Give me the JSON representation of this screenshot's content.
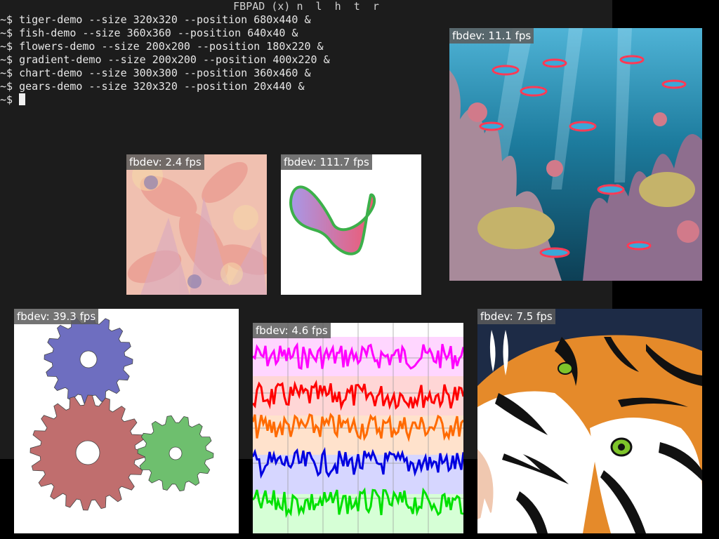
{
  "terminal": {
    "title": "FBPAD (x) n  l  h  t  r",
    "lines": [
      "~$ tiger-demo --size 320x320 --position 680x440 &",
      "~$ fish-demo --size 360x360 --position 640x40 &",
      "~$ flowers-demo --size 200x200 --position 180x220 &",
      "~$ gradient-demo --size 200x200 --position 400x220 &",
      "~$ chart-demo --size 300x300 --position 360x460 &",
      "~$ gears-demo --size 320x320 --position 20x440 &"
    ],
    "prompt": "~$ "
  },
  "windows": {
    "fish": {
      "fps": "fbdev: 11.1 fps"
    },
    "flowers": {
      "fps": "fbdev: 2.4 fps"
    },
    "gradient": {
      "fps": "fbdev: 111.7 fps"
    },
    "gears": {
      "fps": "fbdev: 39.3 fps"
    },
    "chart": {
      "fps": "fbdev: 4.6 fps"
    },
    "tiger": {
      "fps": "fbdev: 7.5 fps"
    }
  },
  "colors": {
    "terminal_bg": "#1c1c1c",
    "gear_blue": "#6e6ec0",
    "gear_red": "#c06e6e",
    "gear_green": "#6ebf6e",
    "chart_series": [
      "#ff00ff",
      "#ff0000",
      "#ff6a00",
      "#0000e0",
      "#00e000"
    ]
  }
}
